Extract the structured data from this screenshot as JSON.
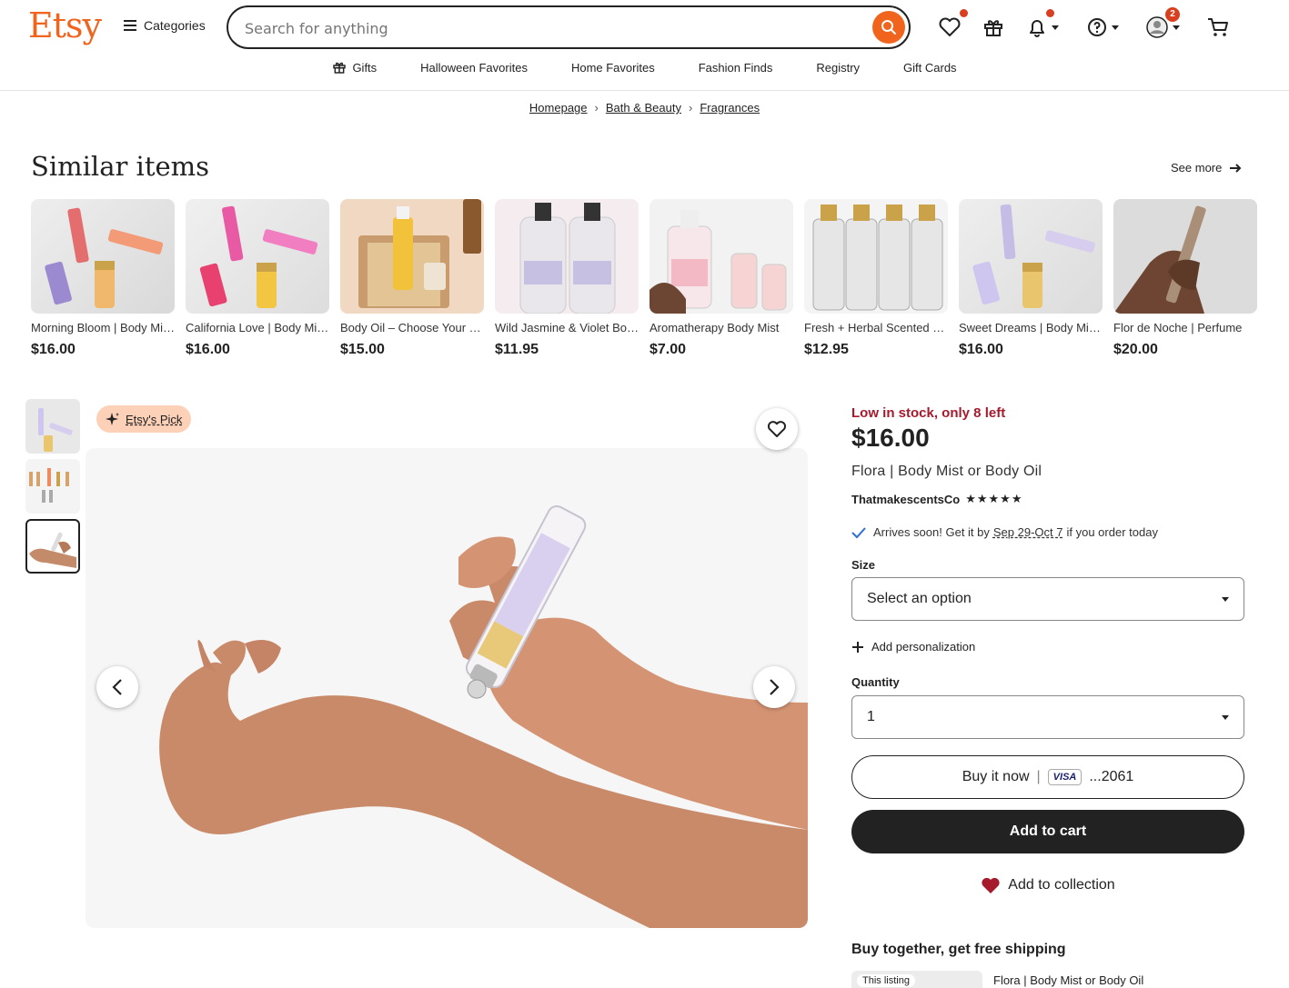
{
  "header": {
    "logo": "Etsy",
    "categories_label": "Categories",
    "search_placeholder": "Search for anything",
    "profile_badge": "2",
    "icons": [
      "favorites-heart-icon",
      "gift-icon",
      "bell-icon",
      "help-icon",
      "account-icon",
      "cart-icon"
    ]
  },
  "nav": {
    "items": [
      "Gifts",
      "Halloween Favorites",
      "Home Favorites",
      "Fashion Finds",
      "Registry",
      "Gift Cards"
    ]
  },
  "breadcrumb": [
    "Homepage",
    "Bath & Beauty",
    "Fragrances"
  ],
  "similar": {
    "title": "Similar items",
    "see_more": "See more",
    "items": [
      {
        "title": "Morning Bloom | Body Mist or Body Oil",
        "price": "$16.00"
      },
      {
        "title": "California Love | Body Mist or Body Oil",
        "price": "$16.00"
      },
      {
        "title": "Body Oil – Choose Your Scent",
        "price": "$15.00"
      },
      {
        "title": "Wild Jasmine & Violet Body Mist",
        "price": "$11.95"
      },
      {
        "title": "Aromatherapy Body Mist",
        "price": "$7.00"
      },
      {
        "title": "Fresh + Herbal Scented Body Mist",
        "price": "$12.95"
      },
      {
        "title": "Sweet Dreams | Body Mist or Body Oil",
        "price": "$16.00"
      },
      {
        "title": "Flor de Noche | Perfume",
        "price": "$20.00"
      }
    ]
  },
  "gallery": {
    "badge": "Etsy's Pick",
    "thumbnail_count": 3,
    "selected_thumbnail": 3
  },
  "listing": {
    "stock": "Low in stock, only 8 left",
    "price": "$16.00",
    "title": "Flora | Body Mist or Body Oil",
    "shop": "ThatmakescentsCo",
    "stars": "★★★★★",
    "arrive_prefix": "Arrives soon! Get it by",
    "arrive_date": "Sep 29-Oct 7",
    "arrive_suffix": "if you order today",
    "size_label": "Size",
    "size_value": "Select an option",
    "personalization": "Add personalization",
    "quantity_label": "Quantity",
    "quantity_value": "1",
    "buy_now": "Buy it now",
    "card_brand": "VISA",
    "card_last4": "...2061",
    "add_to_cart": "Add to cart",
    "add_to_collection": "Add to collection",
    "bundle_title": "Buy together, get free shipping",
    "bundle_tag": "This listing",
    "bundle_item": "Flora | Body Mist or Body Oil"
  },
  "colors": {
    "brand": "#f1641e",
    "stock": "#a61a2e",
    "primary_button": "#222222",
    "pick_badge": "#fdd1b7",
    "heart": "#a61a2e"
  }
}
